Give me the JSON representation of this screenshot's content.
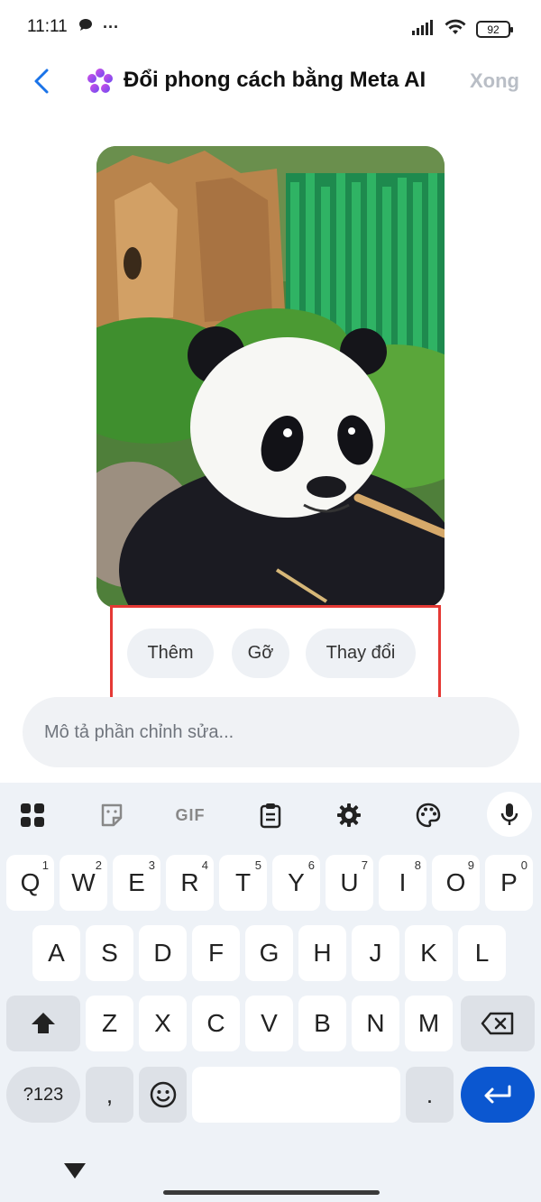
{
  "status_bar": {
    "time": "11:11",
    "more": "···",
    "battery": "92"
  },
  "header": {
    "title": "Đổi phong cách bằng Meta AI",
    "done_label": "Xong"
  },
  "chips": [
    "Thêm",
    "Gỡ",
    "Thay đổi"
  ],
  "input": {
    "placeholder": "Mô tả phần chỉnh sửa..."
  },
  "keyboard": {
    "toolbar": [
      "apps-icon",
      "sticker-icon",
      "GIF",
      "clipboard-icon",
      "settings-icon",
      "palette-icon",
      "mic-icon"
    ],
    "gif_label": "GIF",
    "row1": [
      {
        "k": "Q",
        "h": "1"
      },
      {
        "k": "W",
        "h": "2"
      },
      {
        "k": "E",
        "h": "3"
      },
      {
        "k": "R",
        "h": "4"
      },
      {
        "k": "T",
        "h": "5"
      },
      {
        "k": "Y",
        "h": "6"
      },
      {
        "k": "U",
        "h": "7"
      },
      {
        "k": "I",
        "h": "8"
      },
      {
        "k": "O",
        "h": "9"
      },
      {
        "k": "P",
        "h": "0"
      }
    ],
    "row2": [
      "A",
      "S",
      "D",
      "F",
      "G",
      "H",
      "J",
      "K",
      "L"
    ],
    "row3": [
      "Z",
      "X",
      "C",
      "V",
      "B",
      "N",
      "M"
    ],
    "symbols_label": "?123",
    "comma": ",",
    "period": "."
  },
  "colors": {
    "accent": "#0b57d0",
    "back_arrow": "#1a73e8",
    "highlight_box": "#e53935"
  }
}
